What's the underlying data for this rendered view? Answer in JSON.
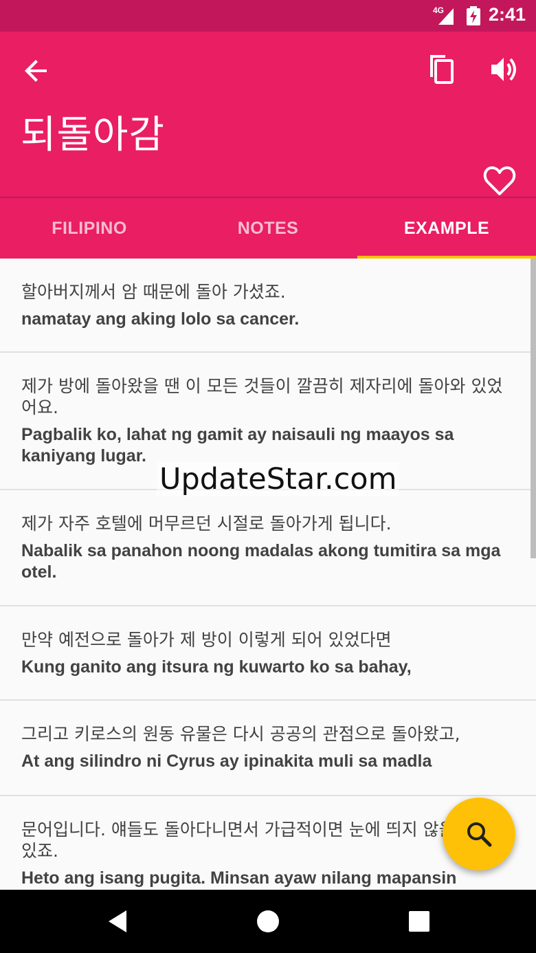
{
  "status_bar": {
    "network": "4G",
    "time": "2:41"
  },
  "header": {
    "word": "되돌아감",
    "back_icon": "arrow-left-icon",
    "copy_icon": "copy-icon",
    "sound_icon": "volume-icon",
    "favorite_icon": "heart-outline-icon"
  },
  "tabs": [
    {
      "label": "FILIPINO",
      "active": false
    },
    {
      "label": "NOTES",
      "active": false
    },
    {
      "label": "EXAMPLE",
      "active": true
    }
  ],
  "examples": [
    {
      "ko": "할아버지께서 암 때문에 돌아 가셨죠.",
      "fil": "namatay ang aking lolo sa cancer."
    },
    {
      "ko": "제가 방에 돌아왔을 땐 이 모든 것들이 깔끔히 제자리에 돌아와 있었어요.",
      "fil": "Pagbalik ko, lahat ng gamit ay naisauli ng maayos sa kaniyang lugar."
    },
    {
      "ko": "제가 자주 호텔에 머무르던 시절로 돌아가게 됩니다.",
      "fil": "Nabalik sa panahon noong madalas akong tumitira sa mga otel."
    },
    {
      "ko": "만약 예전으로 돌아가 제 방이 이렇게 되어 있었다면",
      "fil": "Kung ganito ang itsura ng kuwarto ko sa bahay,"
    },
    {
      "ko": "그리고 키로스의 원동 유물은 다시 공공의 관점으로 돌아왔고,",
      "fil": "At ang silindro ni Cyrus ay ipinakita muli sa madla"
    },
    {
      "ko": "문어입니다. 얘들도 돌아다니면서 가급적이면 눈에 띄지 않을 때가 있죠.",
      "fil": "Heto ang isang pugita. Minsan ayaw nilang mapansin"
    }
  ],
  "watermark": "UpdateStar.com",
  "fab": {
    "icon": "search-icon"
  },
  "nav": {
    "back_icon": "nav-back-icon",
    "home_icon": "nav-home-icon",
    "recent_icon": "nav-recents-icon"
  },
  "colors": {
    "primary": "#e91e63",
    "primary_dark": "#c2185b",
    "accent": "#ffc107"
  }
}
